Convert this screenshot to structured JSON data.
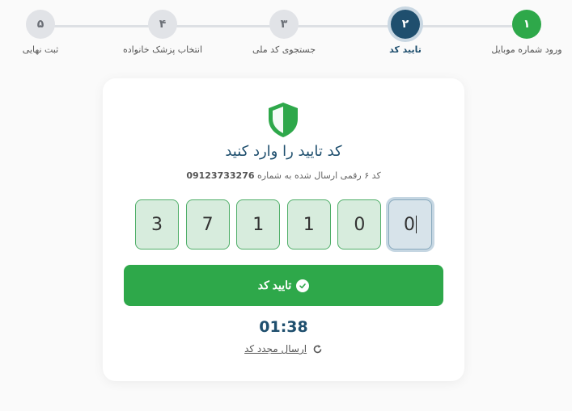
{
  "stepper": {
    "steps": [
      {
        "number": "۱",
        "label": "ورود شماره موبایل",
        "state": "done"
      },
      {
        "number": "۲",
        "label": "تایید کد",
        "state": "active"
      },
      {
        "number": "۳",
        "label": "جستجوی کد ملی",
        "state": "pending"
      },
      {
        "number": "۴",
        "label": "انتخاب پزشک خانواده",
        "state": "pending"
      },
      {
        "number": "۵",
        "label": "ثبت نهایی",
        "state": "pending"
      }
    ]
  },
  "card": {
    "icon": "shield-icon",
    "title": "کد تایید را وارد کنید",
    "subtitle_prefix": "کد ۶ رقمی ارسال شده به شماره",
    "phone": "09123733276",
    "otp_digits": [
      "0",
      "0",
      "1",
      "1",
      "7",
      "3"
    ],
    "confirm_label": "تایید کد",
    "timer": "01:38",
    "resend_label": "ارسال مجدد کد"
  },
  "colors": {
    "success": "#2ea84a",
    "primary": "#1f4f6e"
  }
}
